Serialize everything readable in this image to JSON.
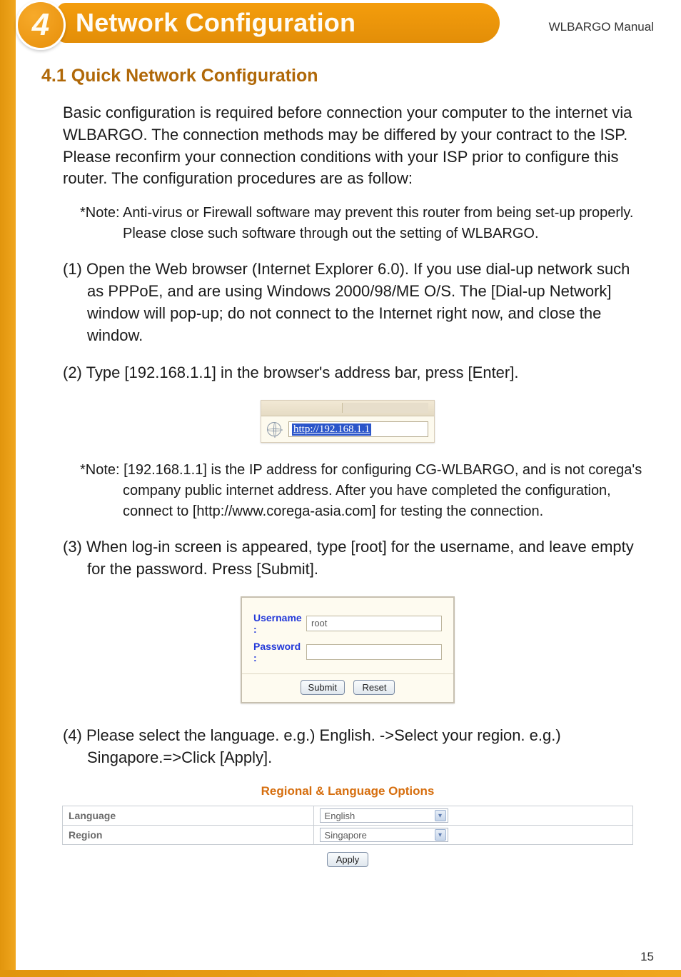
{
  "header": {
    "chapter_number": "4",
    "chapter_title": "Network Configuration",
    "manual_label": "WLBARGO Manual"
  },
  "section": {
    "title": "4.1 Quick Network Configuration",
    "intro": "Basic configuration is required before connection your computer to the internet via WLBARGO. The connection methods may be differed by your contract to the ISP. Please reconfirm your connection conditions with your ISP prior to configure this router. The configuration procedures are as follow:",
    "note1": "*Note: Anti-virus or Firewall software may prevent this router from being set-up properly. Please close such software through out the setting of WLBARGO.",
    "step1": "(1) Open the Web browser (Internet Explorer 6.0). If you use dial-up network such as PPPoE, and are using Windows 2000/98/ME O/S. The [Dial-up Network] window will pop-up; do not connect to the Internet right now, and close the window.",
    "step2": "(2) Type [192.168.1.1] in the browser's address bar, press [Enter].",
    "addr_url": "http://192.168.1.1",
    "note2": "*Note: [192.168.1.1] is the IP address for configuring CG-WLBARGO, and is not corega's company public internet address. After you have completed the configuration, connect to [http://www.corega-asia.com] for testing the connection.",
    "step3": "(3) When log-in screen is appeared, type [root] for the username, and leave empty for the password. Press [Submit].",
    "login": {
      "username_label": "Username :",
      "username_value": "root",
      "password_label": "Password :",
      "password_value": "",
      "submit": "Submit",
      "reset": "Reset"
    },
    "step4": "(4) Please select the language. e.g.) English. ->Select your region. e.g.) Singapore.=>Click  [Apply].",
    "regional": {
      "title": "Regional & Language Options",
      "language_label": "Language",
      "language_value": "English",
      "region_label": "Region",
      "region_value": "Singapore",
      "apply": "Apply"
    }
  },
  "page_number": "15"
}
